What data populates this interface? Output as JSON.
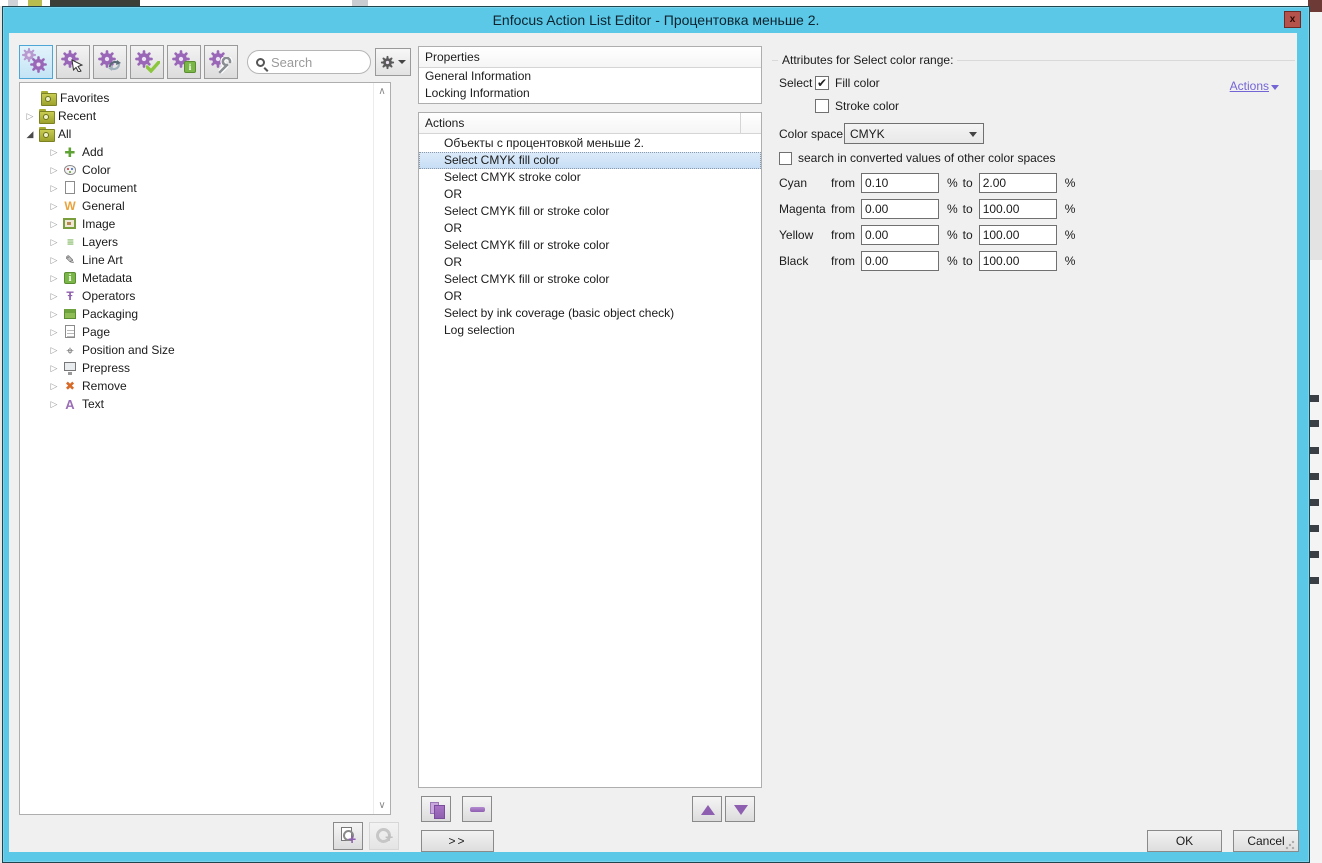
{
  "window": {
    "title": "Enfocus Action List Editor - Процентовка меньше 2.",
    "close_label": "x"
  },
  "toolbar": {
    "search_placeholder": "Search",
    "buttons": [
      {
        "name": "all-actions",
        "selected": true
      },
      {
        "name": "select-actions",
        "selected": false
      },
      {
        "name": "change-actions",
        "selected": false
      },
      {
        "name": "check-actions",
        "selected": false
      },
      {
        "name": "inform-actions",
        "selected": false
      },
      {
        "name": "fix-actions",
        "selected": false
      }
    ]
  },
  "tree": {
    "items": [
      {
        "label": "Favorites"
      },
      {
        "label": "Recent"
      },
      {
        "label": "All"
      },
      {
        "label": "Add"
      },
      {
        "label": "Color"
      },
      {
        "label": "Document"
      },
      {
        "label": "General"
      },
      {
        "label": "Image"
      },
      {
        "label": "Layers"
      },
      {
        "label": "Line Art"
      },
      {
        "label": "Metadata"
      },
      {
        "label": "Operators"
      },
      {
        "label": "Packaging"
      },
      {
        "label": "Page"
      },
      {
        "label": "Position and Size"
      },
      {
        "label": "Prepress"
      },
      {
        "label": "Remove"
      },
      {
        "label": "Text"
      }
    ]
  },
  "properties_panel": {
    "header": "Properties",
    "rows": [
      "General Information",
      "Locking Information"
    ]
  },
  "actions_panel": {
    "header": "Actions",
    "rows": [
      {
        "label": "Объекты с процентовкой меньше 2."
      },
      {
        "label": "Select CMYK fill color",
        "selected": true
      },
      {
        "label": "Select CMYK stroke color"
      },
      {
        "label": "OR"
      },
      {
        "label": "Select CMYK fill or stroke color"
      },
      {
        "label": "OR"
      },
      {
        "label": "Select CMYK fill or stroke color"
      },
      {
        "label": "OR"
      },
      {
        "label": "Select CMYK fill or stroke color"
      },
      {
        "label": "OR"
      },
      {
        "label": "Select by ink coverage (basic object check)"
      },
      {
        "label": "Log selection"
      }
    ]
  },
  "attributes_panel": {
    "title": "Attributes for Select color range:",
    "actions_link": "Actions",
    "select_label": "Select",
    "fill_color": {
      "label": "Fill color",
      "checked": true
    },
    "stroke_color": {
      "label": "Stroke color",
      "checked": false
    },
    "color_space_label": "Color space",
    "color_space_value": "CMYK",
    "search_converted": {
      "label": "search in converted values of other color spaces",
      "checked": false
    },
    "range_rows": [
      {
        "label": "Cyan",
        "from_label": "from",
        "from": "0.10",
        "unit1": "%",
        "to_label": "to",
        "to": "2.00",
        "unit2": "%"
      },
      {
        "label": "Magenta",
        "from_label": "from",
        "from": "0.00",
        "unit1": "%",
        "to_label": "to",
        "to": "100.00",
        "unit2": "%"
      },
      {
        "label": "Yellow",
        "from_label": "from",
        "from": "0.00",
        "unit1": "%",
        "to_label": "to",
        "to": "100.00",
        "unit2": "%"
      },
      {
        "label": "Black",
        "from_label": "from",
        "from": "0.00",
        "unit1": "%",
        "to_label": "to",
        "to": "100.00",
        "unit2": "%"
      }
    ]
  },
  "footer": {
    "expand_button": ">>",
    "ok": "OK",
    "cancel": "Cancel"
  },
  "colors": {
    "titlebar": "#5ac8e6",
    "close_button": "#b4524b",
    "selection": "#cfe3f8",
    "accent_purple": "#8e5fb0",
    "link": "#7465d6"
  }
}
